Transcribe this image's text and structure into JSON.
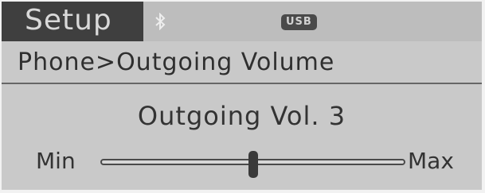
{
  "header": {
    "title": "Setup",
    "bluetooth_icon": "bluetooth-icon",
    "usb_badge": "USB"
  },
  "breadcrumb": "Phone>Outgoing Volume",
  "volume": {
    "title": "Outgoing Vol. 3",
    "min_label": "Min",
    "max_label": "Max",
    "level_fraction": 0.5
  },
  "colors": {
    "screen_bg": "#c9c9c9",
    "tab_bg": "#3f3f3f",
    "text": "#333333"
  }
}
